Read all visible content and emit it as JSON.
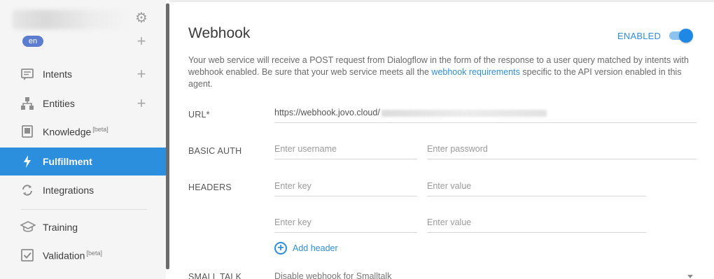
{
  "sidebar": {
    "language": "en",
    "items": [
      {
        "label": "Intents",
        "beta": "",
        "icon": "chat-bubble-icon"
      },
      {
        "label": "Entities",
        "beta": "",
        "icon": "hierarchy-icon"
      },
      {
        "label": "Knowledge",
        "beta": "[beta]",
        "icon": "book-icon"
      },
      {
        "label": "Fulfillment",
        "beta": "",
        "icon": "lightning-icon"
      },
      {
        "label": "Integrations",
        "beta": "",
        "icon": "sync-icon"
      },
      {
        "label": "Training",
        "beta": "",
        "icon": "graduation-cap-icon"
      },
      {
        "label": "Validation",
        "beta": "[beta]",
        "icon": "checkbox-icon"
      }
    ],
    "active_item": "Fulfillment",
    "colors": {
      "active_bg": "#2c8fde",
      "sidebar_bg": "#f5f5f5"
    }
  },
  "webhook": {
    "title": "Webhook",
    "enabled_label": "ENABLED",
    "enabled": true,
    "description_pre": "Your web service will receive a POST request from Dialogflow in the form of the response to a user query matched by intents with webhook enabled. Be sure that your web service meets all the ",
    "description_link": "webhook requirements",
    "description_post": " specific to the API version enabled in this agent.",
    "url_label": "URL*",
    "url_value": "https://webhook.jovo.cloud/",
    "basic_auth_label": "BASIC AUTH",
    "username_placeholder": "Enter username",
    "password_placeholder": "Enter password",
    "headers_label": "HEADERS",
    "header_rows": [
      {
        "key_placeholder": "Enter key",
        "value_placeholder": "Enter value"
      },
      {
        "key_placeholder": "Enter key",
        "value_placeholder": "Enter value"
      }
    ],
    "add_header_label": "Add header",
    "small_talk_label": "SMALL TALK",
    "small_talk_value": "Disable webhook for Smalltalk"
  }
}
